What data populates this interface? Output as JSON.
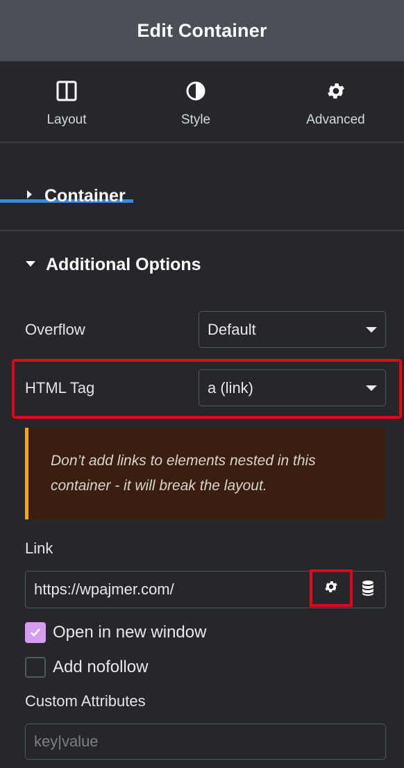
{
  "header": {
    "title": "Edit Container"
  },
  "tabs": [
    {
      "label": "Layout",
      "icon": "columns-icon",
      "active": true
    },
    {
      "label": "Style",
      "icon": "contrast-icon",
      "active": false
    },
    {
      "label": "Advanced",
      "icon": "gear-icon",
      "active": false
    }
  ],
  "sections": {
    "container": {
      "title": "Container",
      "expanded": false
    },
    "additional": {
      "title": "Additional Options",
      "expanded": true
    }
  },
  "fields": {
    "overflow": {
      "label": "Overflow",
      "value": "Default"
    },
    "html_tag": {
      "label": "HTML Tag",
      "value": "a (link)"
    },
    "notice": "Don’t add links to elements nested in this container - it will break the layout.",
    "link": {
      "label": "Link",
      "value": "https://wpajmer.com/"
    },
    "open_new_window": {
      "label": "Open in new window",
      "checked": true
    },
    "nofollow": {
      "label": "Add nofollow",
      "checked": false
    },
    "custom_attributes": {
      "label": "Custom Attributes",
      "placeholder": "key|value"
    }
  },
  "colors": {
    "accent_tab": "#3c8ae8",
    "highlight": "#e0041a",
    "notice_border": "#f5a623",
    "checkbox_checked": "#d59cf0"
  }
}
